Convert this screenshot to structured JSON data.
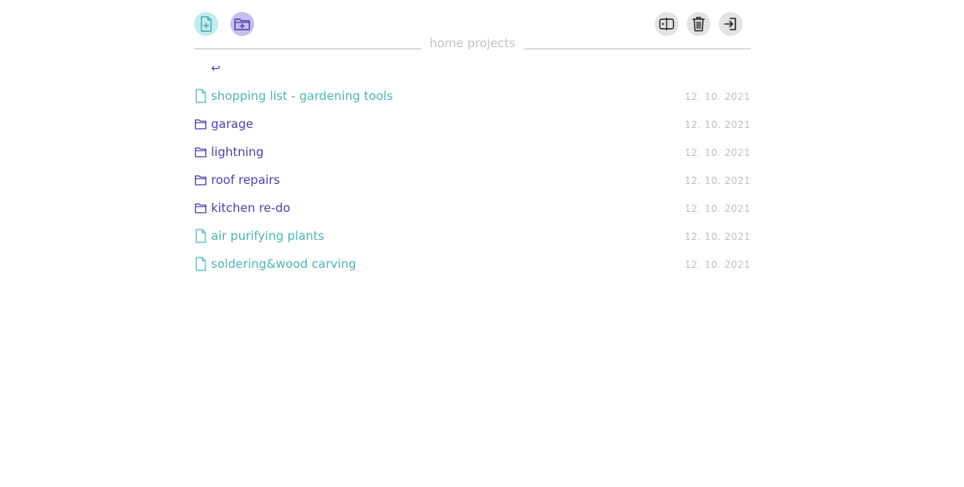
{
  "toolbar": {
    "icons": [
      "new-file-icon",
      "new-folder-icon",
      "split-view-icon",
      "trash-icon",
      "exit-icon"
    ],
    "colors": {
      "new_file_bg": "#c4e9ee",
      "new_file_fg": "#3ea8ad",
      "new_folder_bg": "#c8bfee",
      "new_folder_fg": "#4e3fa8",
      "neutral_bg": "#e3e3e3"
    }
  },
  "header": {
    "title": "home projects"
  },
  "navigation": {
    "back_glyph": "↩"
  },
  "items": [
    {
      "type": "file",
      "name": "shopping list - gardening tools",
      "date": "12. 10. 2021"
    },
    {
      "type": "folder",
      "name": "garage",
      "date": "12. 10. 2021"
    },
    {
      "type": "folder",
      "name": "lightning",
      "date": "12. 10. 2021"
    },
    {
      "type": "folder",
      "name": "roof repairs",
      "date": "12. 10. 2021"
    },
    {
      "type": "folder",
      "name": "kitchen re-do",
      "date": "12. 10. 2021"
    },
    {
      "type": "file",
      "name": "air purifying plants",
      "date": "12. 10. 2021"
    },
    {
      "type": "file",
      "name": "soldering&wood carving",
      "date": "12. 10. 2021"
    }
  ],
  "colors": {
    "file_text": "#4fb3b7",
    "folder_text": "#4e3fa8",
    "date_text": "#c0c0c0",
    "title_text": "#c3c3c3"
  }
}
